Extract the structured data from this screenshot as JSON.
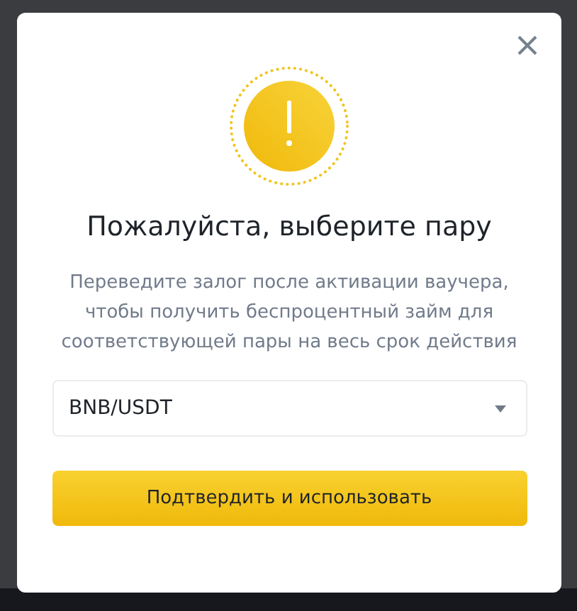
{
  "dialog": {
    "title": "Пожалуйста, выберите пару",
    "description": "Переведите залог после активации ваучера, чтобы получить беспроцентный займ для соответствующей пары на весь срок действия",
    "select": {
      "value": "BNB/USDT"
    },
    "confirm_button": "Подтвердить и использовать"
  }
}
